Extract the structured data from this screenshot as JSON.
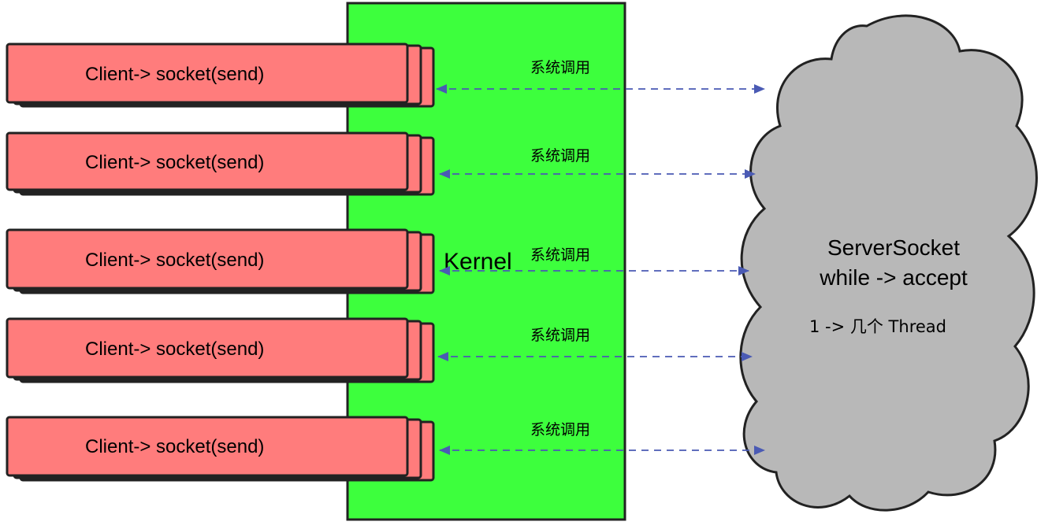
{
  "kernel": {
    "label": "Kernel",
    "fill": "#3dff3d"
  },
  "client_fill": "#ff7c7c",
  "clients": [
    {
      "label": "Client-> socket(send)",
      "call_label": "系统调用"
    },
    {
      "label": "Client-> socket(send)",
      "call_label": "系统调用"
    },
    {
      "label": "Client-> socket(send)",
      "call_label": "系统调用"
    },
    {
      "label": "Client-> socket(send)",
      "call_label": "系统调用"
    },
    {
      "label": "Client-> socket(send)",
      "call_label": "系统调用"
    }
  ],
  "server": {
    "line1": "ServerSocket",
    "line2": "while -> accept",
    "thread_note": "1 -> 几个 Thread",
    "fill": "#b8b8b8"
  },
  "arrow_color": "#4a5ab4"
}
